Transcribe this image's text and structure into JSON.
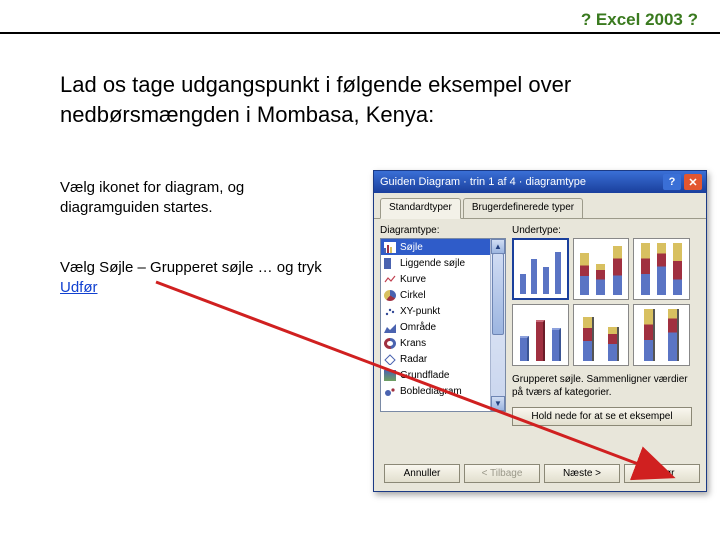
{
  "header": {
    "title": "? Excel 2003 ?"
  },
  "heading": "Lad os tage udgangspunkt i følgende eksempel over nedbørsmængden i Mombasa, Kenya:",
  "para1": "Vælg ikonet for diagram, og diagramguiden startes.",
  "para2_a": "Vælg Søjle – Grupperet søjle … og tryk ",
  "para2_link": "Udfør",
  "wizard": {
    "title": "Guiden Diagram · trin 1 af 4 · diagramtype",
    "tabs": {
      "standard": "Standardtyper",
      "custom": "Brugerdefinerede typer"
    },
    "labels": {
      "type": "Diagramtype:",
      "subtype": "Undertype:"
    },
    "types": [
      "Søjle",
      "Liggende søjle",
      "Kurve",
      "Cirkel",
      "XY-punkt",
      "Område",
      "Krans",
      "Radar",
      "Grundflade",
      "Boblediagram"
    ],
    "selected_type_index": 0,
    "desc": "Grupperet søjle. Sammenligner værdier på tværs af kategorier.",
    "hold_button": "Hold nede for at se et eksempel",
    "buttons": {
      "cancel": "Annuller",
      "back": "< Tilbage",
      "next": "Næste >",
      "finish": "Udfør"
    }
  }
}
